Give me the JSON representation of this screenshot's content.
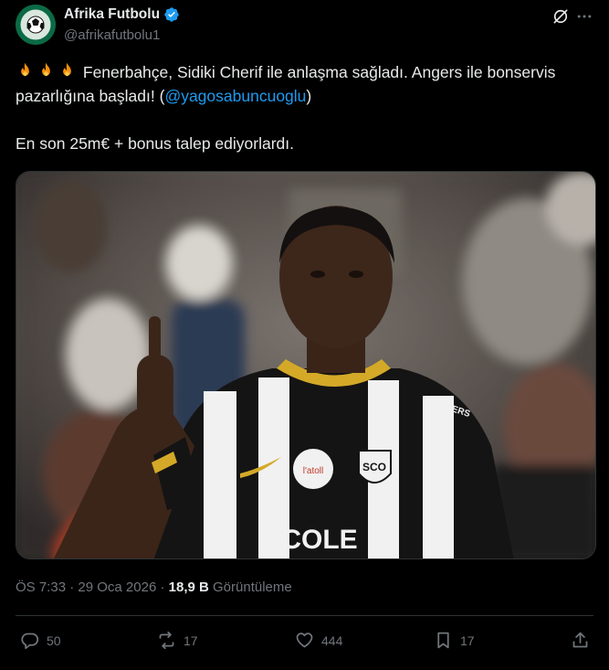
{
  "author": {
    "name": "Afrika Futbolu",
    "handle": "@afrikafutbolu1",
    "verified": true,
    "avatar_text": "AFRIKA FUTBOLU"
  },
  "tweet": {
    "line1_text": "Fenerbahçe, Sidiki Cherif ile anlaşma sağladı. Angers ile bonservis pazarlığına başladı! (",
    "mention": "@yagosabuncuoglu",
    "line1_close": ")",
    "line2_text": "En son 25m€ + bonus talep ediyorlardı."
  },
  "media": {
    "description_icon": "photo-of-football-player",
    "jersey_brand": "ANGERS",
    "badge_text": "SCO",
    "sponsor_text": "ECOLE",
    "sponsor_logo_text": "l'atoll"
  },
  "meta": {
    "time": "ÖS 7:33",
    "separator": "·",
    "date": "29 Oca 2026",
    "views_count": "18,9 B",
    "views_label": "Görüntüleme"
  },
  "actions": {
    "replies": "50",
    "retweets": "17",
    "likes": "444",
    "bookmarks": "17"
  },
  "colors": {
    "background": "#000000",
    "text": "#e7e9ea",
    "muted": "#71767b",
    "accent": "#1d9bf0"
  }
}
